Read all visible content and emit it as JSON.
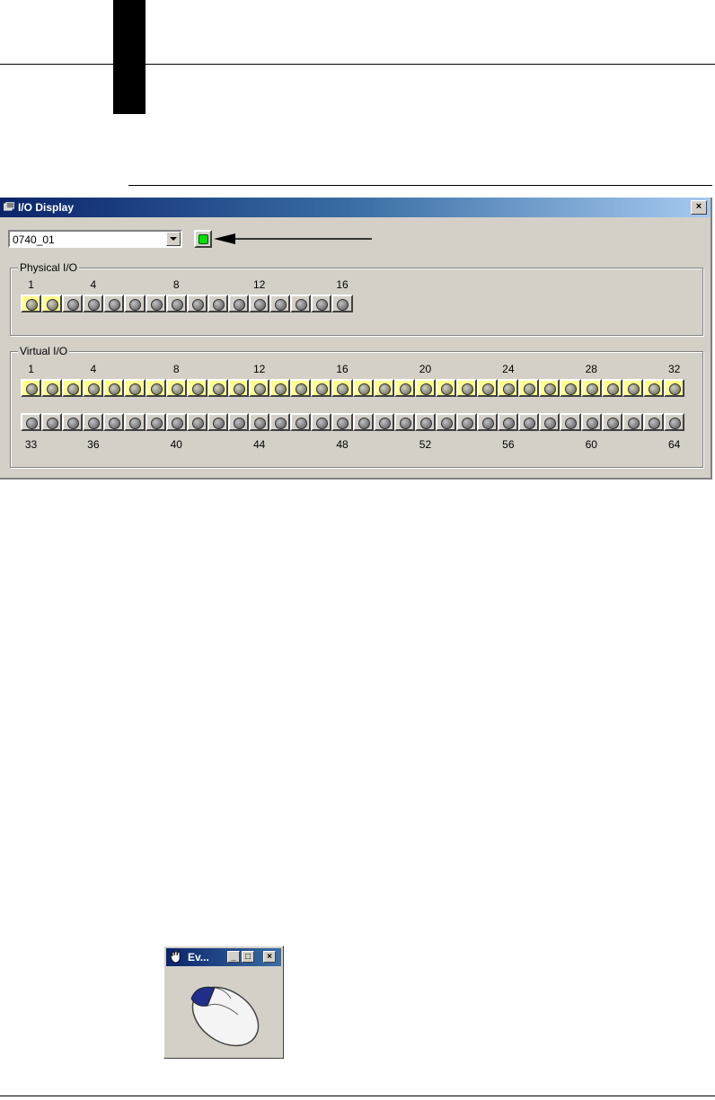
{
  "window": {
    "title": "I/O Display",
    "close_glyph": "×",
    "combo_value": "0740_01"
  },
  "physical": {
    "label": "Physical I/O",
    "tick_labels": [
      {
        "n": 1,
        "text": "1"
      },
      {
        "n": 4,
        "text": "4"
      },
      {
        "n": 8,
        "text": "8"
      },
      {
        "n": 12,
        "text": "12"
      },
      {
        "n": 16,
        "text": "16"
      }
    ],
    "count": 16,
    "on": [
      1,
      2
    ]
  },
  "virtual": {
    "label": "Virtual I/O",
    "top_labels": [
      {
        "n": 1,
        "text": "1"
      },
      {
        "n": 4,
        "text": "4"
      },
      {
        "n": 8,
        "text": "8"
      },
      {
        "n": 12,
        "text": "12"
      },
      {
        "n": 16,
        "text": "16"
      },
      {
        "n": 20,
        "text": "20"
      },
      {
        "n": 24,
        "text": "24"
      },
      {
        "n": 28,
        "text": "28"
      },
      {
        "n": 32,
        "text": "32"
      }
    ],
    "bottom_labels": [
      {
        "n": 1,
        "text": "33"
      },
      {
        "n": 4,
        "text": "36"
      },
      {
        "n": 8,
        "text": "40"
      },
      {
        "n": 12,
        "text": "44"
      },
      {
        "n": 16,
        "text": "48"
      },
      {
        "n": 20,
        "text": "52"
      },
      {
        "n": 24,
        "text": "56"
      },
      {
        "n": 28,
        "text": "60"
      },
      {
        "n": 32,
        "text": "64"
      }
    ],
    "row1_count": 32,
    "row1_on": "all",
    "row2_count": 32
  },
  "event_window": {
    "title": "Ev...",
    "minimize_glyph": "_",
    "maximize_glyph": "□",
    "close_glyph": "×"
  },
  "colors": {
    "led_on_bg": "#fdfd90",
    "status_green": "#00e000"
  }
}
